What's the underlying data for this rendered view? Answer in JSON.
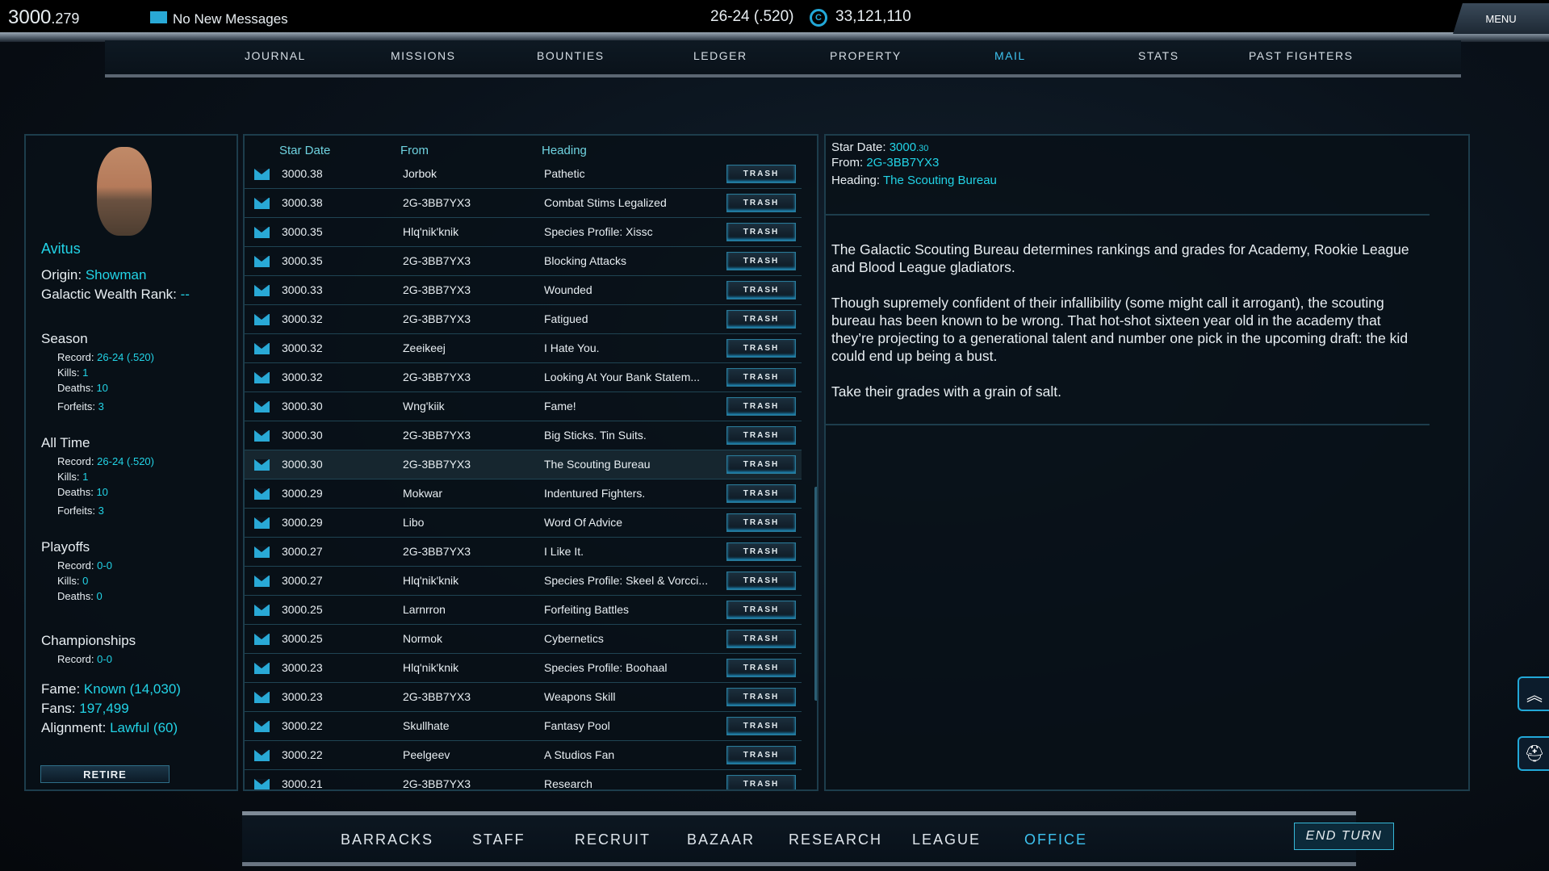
{
  "top": {
    "date_main": "3000",
    "date_frac": ".279",
    "messages": "No New Messages",
    "record": "26-24 (.520)",
    "credits": "33,121,110",
    "menu": "MENU"
  },
  "nav": [
    {
      "label": "JOURNAL"
    },
    {
      "label": "MISSIONS"
    },
    {
      "label": "BOUNTIES"
    },
    {
      "label": "LEDGER"
    },
    {
      "label": "PROPERTY"
    },
    {
      "label": "MAIL",
      "active": true
    },
    {
      "label": "STATS"
    },
    {
      "label": "PAST FIGHTERS"
    }
  ],
  "fighter": {
    "name": "Avitus",
    "origin_label": "Origin:",
    "origin": "Showman",
    "wealth_label": "Galactic Wealth Rank:",
    "wealth": "--",
    "season": {
      "title": "Season",
      "record": "26-24 (.520)",
      "kills": "1",
      "deaths": "10",
      "forfeits": "3"
    },
    "alltime": {
      "title": "All Time",
      "record": "26-24 (.520)",
      "kills": "1",
      "deaths": "10",
      "forfeits": "3"
    },
    "playoffs": {
      "title": "Playoffs",
      "record": "0-0",
      "kills": "0",
      "deaths": "0"
    },
    "championships": {
      "title": "Championships",
      "record": "0-0"
    },
    "labels": {
      "record": "Record:",
      "kills": "Kills:",
      "deaths": "Deaths:",
      "forfeits": "Forfeits:",
      "fame": "Fame:",
      "fans": "Fans:",
      "alignment": "Alignment:"
    },
    "fame": "Known (14,030)",
    "fans": "197,499",
    "alignment": "Lawful (60)",
    "retire": "RETIRE"
  },
  "mail": {
    "headers": {
      "date": "Star Date",
      "from": "From",
      "heading": "Heading"
    },
    "trash_label": "TRASH",
    "rows": [
      [
        "3000.38",
        "Jorbok",
        "Pathetic"
      ],
      [
        "3000.38",
        "2G-3BB7YX3",
        "Combat Stims Legalized"
      ],
      [
        "3000.35",
        "Hlq'nik'knik",
        "Species Profile: Xissc"
      ],
      [
        "3000.35",
        "2G-3BB7YX3",
        "Blocking Attacks"
      ],
      [
        "3000.33",
        "2G-3BB7YX3",
        "Wounded"
      ],
      [
        "3000.32",
        "2G-3BB7YX3",
        "Fatigued"
      ],
      [
        "3000.32",
        "Zeeikeej",
        "I Hate You."
      ],
      [
        "3000.32",
        "2G-3BB7YX3",
        "Looking At Your Bank Statem..."
      ],
      [
        "3000.30",
        "Wng'kiik",
        "Fame!"
      ],
      [
        "3000.30",
        "2G-3BB7YX3",
        "Big Sticks. Tin Suits."
      ],
      [
        "3000.30",
        "2G-3BB7YX3",
        "The Scouting Bureau"
      ],
      [
        "3000.29",
        "Mokwar",
        "Indentured Fighters."
      ],
      [
        "3000.29",
        "Libo",
        "Word Of Advice"
      ],
      [
        "3000.27",
        "2G-3BB7YX3",
        "I Like It."
      ],
      [
        "3000.27",
        "Hlq'nik'knik",
        "Species Profile: Skeel & Vorcci..."
      ],
      [
        "3000.25",
        "Larnrron",
        "Forfeiting Battles"
      ],
      [
        "3000.25",
        "Normok",
        "Cybernetics"
      ],
      [
        "3000.23",
        "Hlq'nik'knik",
        "Species Profile: Boohaal"
      ],
      [
        "3000.23",
        "2G-3BB7YX3",
        "Weapons Skill"
      ],
      [
        "3000.22",
        "Skullhate",
        "Fantasy Pool"
      ],
      [
        "3000.22",
        "Peelgeev",
        "A Studios Fan"
      ],
      [
        "3000.21",
        "2G-3BB7YX3",
        "Research"
      ]
    ],
    "selected_index": 10
  },
  "detail": {
    "date_label": "Star Date:",
    "date_main": "3000",
    "date_frac": ".30",
    "from_label": "From:",
    "from": "2G-3BB7YX3",
    "heading_label": "Heading:",
    "heading": "The Scouting Bureau",
    "body": [
      "The Galactic Scouting Bureau determines rankings and grades for Academy, Rookie League and Blood League gladiators.",
      "Though supremely confident of their infallibility (some might call it arrogant), the scouting bureau has been known to be wrong. That hot-shot sixteen year old in the academy that they’re projecting to a generational talent and number one pick in the upcoming draft: the kid could end up being a bust.",
      "Take their grades with a grain of salt."
    ]
  },
  "bottom": [
    {
      "label": "BARRACKS"
    },
    {
      "label": "STAFF"
    },
    {
      "label": "RECRUIT"
    },
    {
      "label": "BAZAAR"
    },
    {
      "label": "RESEARCH"
    },
    {
      "label": "LEAGUE"
    },
    {
      "label": "OFFICE",
      "active": true
    }
  ],
  "end_turn": "END TURN",
  "side_icons": [
    "rank-chevrons-icon",
    "spartan-helmet-icon"
  ],
  "colors": {
    "accent": "#22d3e6",
    "active_nav": "#3ec3f0",
    "envelope": "#29a9d6"
  }
}
